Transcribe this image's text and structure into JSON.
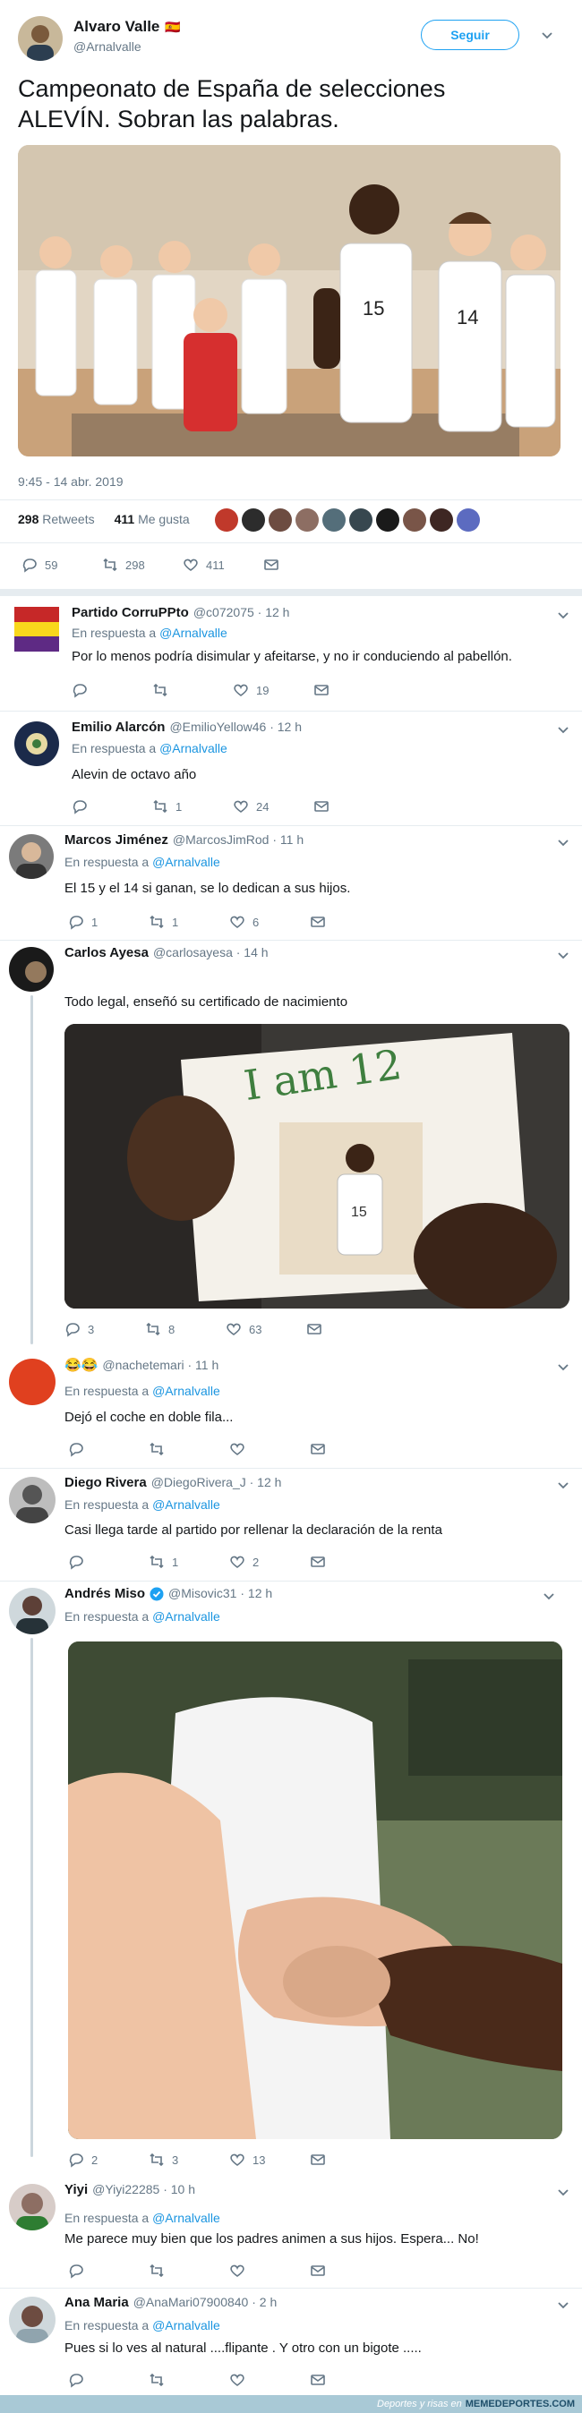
{
  "main_tweet": {
    "author_name": "Alvaro Valle",
    "flag": "🇪🇸",
    "handle": "@Arnalvalle",
    "follow_label": "Seguir",
    "text_line1": "Campeonato de España de selecciones",
    "text_line2": "ALEVÍN. Sobran las palabras.",
    "timestamp": "9:45 - 14 abr. 2019",
    "retweets_count": "298",
    "retweets_label": "Retweets",
    "likes_count": "411",
    "likes_label": "Me gusta",
    "actions": {
      "replies": "59",
      "retweets": "298",
      "likes": "411"
    }
  },
  "replies": [
    {
      "name": "Partido CorruPPto",
      "handle": "@c072075 · 12 h",
      "reply_prefix": "En respuesta a",
      "reply_to": "@Arnalvalle",
      "text": "Por lo menos podría disimular y afeitarse, y no ir conduciendo al pabellón.",
      "replies": "",
      "retweets": "",
      "likes": "19"
    },
    {
      "name": "Emilio Alarcón",
      "handle": "@EmilioYellow46 · 12 h",
      "reply_prefix": "En respuesta a",
      "reply_to": "@Arnalvalle",
      "text": "Alevin de octavo año",
      "replies": "",
      "retweets": "1",
      "likes": "24"
    },
    {
      "name": "Marcos Jiménez",
      "handle": "@MarcosJimRod · 11 h",
      "reply_prefix": "En respuesta a",
      "reply_to": "@Arnalvalle",
      "text": "El 15 y el 14 si ganan, se lo dedican a sus hijos.",
      "replies": "1",
      "retweets": "1",
      "likes": "6"
    },
    {
      "name": "Carlos Ayesa",
      "handle": "@carlosayesa · 14 h",
      "reply_prefix": "",
      "reply_to": "",
      "text": "Todo legal, enseñó su certificado de nacimiento",
      "replies": "3",
      "retweets": "8",
      "likes": "63"
    },
    {
      "name": "😂😂",
      "handle": "@nachetemari · 11 h",
      "reply_prefix": "En respuesta a",
      "reply_to": "@Arnalvalle",
      "text": "Dejó el coche en doble fila...",
      "replies": "",
      "retweets": "",
      "likes": ""
    },
    {
      "name": "Diego Rivera",
      "handle": "@DiegoRivera_J · 12 h",
      "reply_prefix": "En respuesta a",
      "reply_to": "@Arnalvalle",
      "text": "Casi llega tarde al partido por rellenar la declaración de la renta",
      "replies": "",
      "retweets": "1",
      "likes": "2"
    },
    {
      "name": "Andrés Miso",
      "handle": "@Misovic31 · 12 h",
      "reply_prefix": "En respuesta a",
      "reply_to": "@Arnalvalle",
      "text": "",
      "replies": "2",
      "retweets": "3",
      "likes": "13"
    },
    {
      "name": "Yiyi",
      "handle": "@Yiyi22285 · 10 h",
      "reply_prefix": "En respuesta a",
      "reply_to": "@Arnalvalle",
      "text": "Me parece muy bien que los padres animen a sus hijos. Espera... No!",
      "replies": "",
      "retweets": "",
      "likes": ""
    },
    {
      "name": "Ana Maria",
      "handle": "@AnaMari07900840 · 2 h",
      "reply_prefix": "En respuesta a",
      "reply_to": "@Arnalvalle",
      "text": "Pues si lo ves al natural ....flipante . Y otro con un bigote .....",
      "replies": "",
      "retweets": "",
      "likes": ""
    }
  ],
  "note_text": "I am 12",
  "footer": {
    "left": "Deportes y risas en",
    "right": "MEMEDEPORTES.COM"
  }
}
